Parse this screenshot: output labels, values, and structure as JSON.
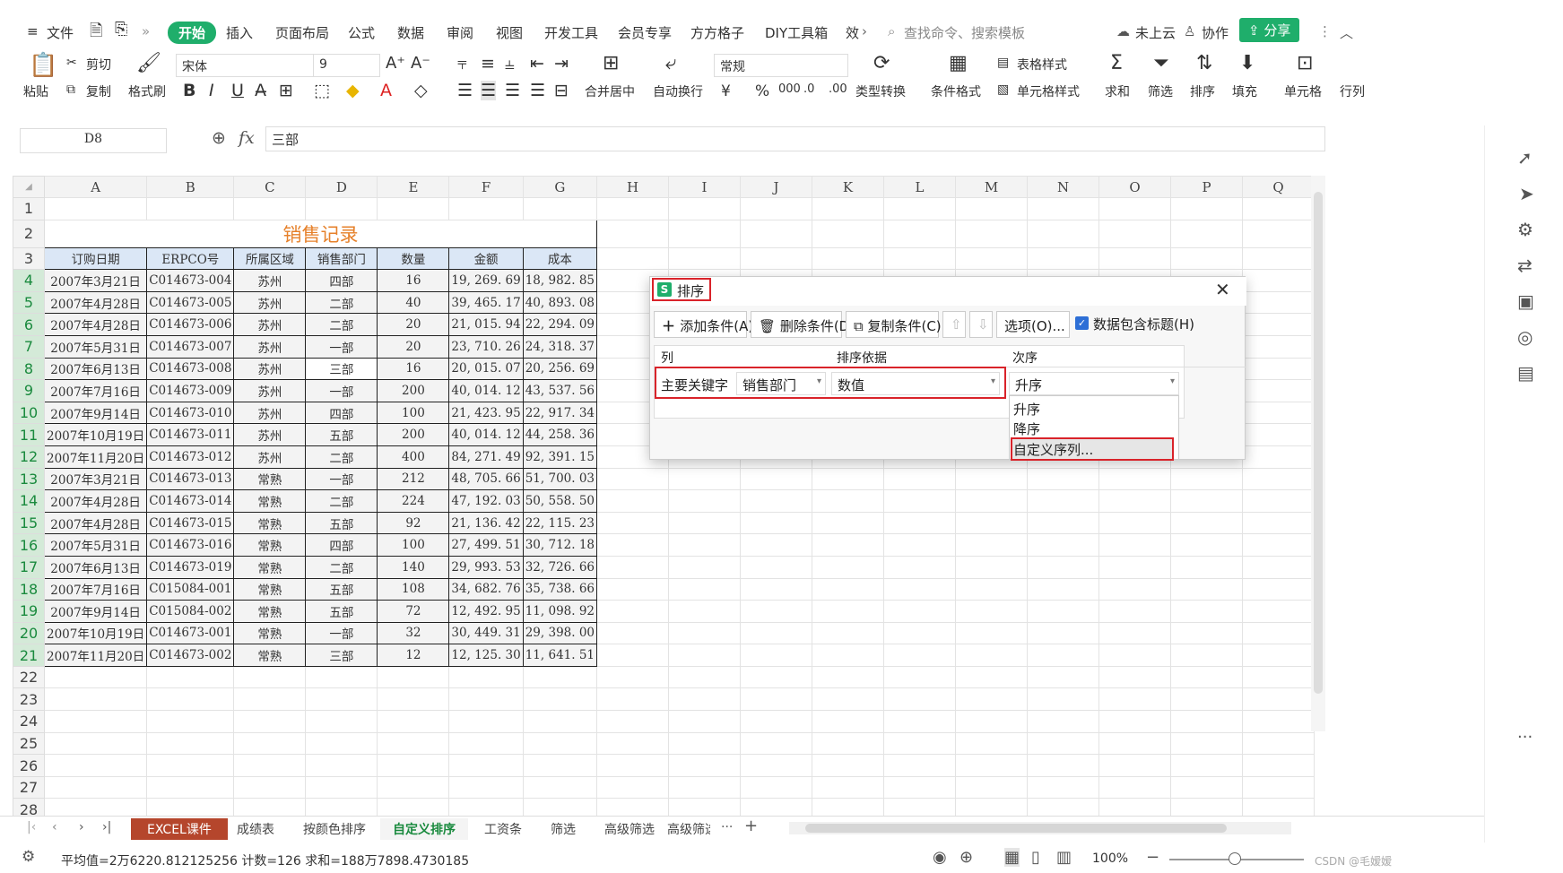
{
  "menubar": {
    "hamburger": "≡",
    "file": "文件",
    "more": "»",
    "tabs": [
      "开始",
      "插入",
      "页面布局",
      "公式",
      "数据",
      "审阅",
      "视图",
      "开发工具",
      "会员专享",
      "方方格子",
      "DIY工具箱",
      "效"
    ],
    "search": "查找命令、搜索模板",
    "cloud": "未上云",
    "collab": "协作",
    "share": "分享"
  },
  "ribbon": {
    "paste": "粘贴",
    "cut": "剪切",
    "copy": "复制",
    "format_painter": "格式刷",
    "font": "宋体",
    "size": "9",
    "merge": "合并居中",
    "wrap": "自动换行",
    "numfmt": "常规",
    "typeconv": "类型转换",
    "condfmt": "条件格式",
    "tablestyle": "表格样式",
    "cellstyle": "单元格样式",
    "sum": "求和",
    "filter": "筛选",
    "sort": "排序",
    "fill": "填充",
    "cell": "单元格",
    "rowcol": "行列",
    "currency": "¥",
    "percent": "%"
  },
  "formula": {
    "cellref": "D8",
    "fx": "fx",
    "value": "三部"
  },
  "grid": {
    "cols": [
      "A",
      "B",
      "C",
      "D",
      "E",
      "F",
      "G",
      "H",
      "I",
      "J",
      "K",
      "L",
      "M",
      "N",
      "O",
      "P",
      "Q"
    ],
    "rows": [
      "1",
      "2",
      "3",
      "4",
      "5",
      "6",
      "7",
      "8",
      "9",
      "10",
      "11",
      "12",
      "13",
      "14",
      "15",
      "16",
      "17",
      "18",
      "19",
      "20",
      "21",
      "22",
      "23",
      "24",
      "25",
      "26",
      "27",
      "28"
    ],
    "title": "销售记录",
    "headers": [
      "订购日期",
      "ERPCO号",
      "所属区域",
      "销售部门",
      "数量",
      "金额",
      "成本"
    ],
    "data": [
      [
        "2007年3月21日",
        "C014673-004",
        "苏州",
        "四部",
        "16",
        "19, 269. 69",
        "18, 982. 85"
      ],
      [
        "2007年4月28日",
        "C014673-005",
        "苏州",
        "二部",
        "40",
        "39, 465. 17",
        "40, 893. 08"
      ],
      [
        "2007年4月28日",
        "C014673-006",
        "苏州",
        "二部",
        "20",
        "21, 015. 94",
        "22, 294. 09"
      ],
      [
        "2007年5月31日",
        "C014673-007",
        "苏州",
        "一部",
        "20",
        "23, 710. 26",
        "24, 318. 37"
      ],
      [
        "2007年6月13日",
        "C014673-008",
        "苏州",
        "三部",
        "16",
        "20, 015. 07",
        "20, 256. 69"
      ],
      [
        "2007年7月16日",
        "C014673-009",
        "苏州",
        "一部",
        "200",
        "40, 014. 12",
        "43, 537. 56"
      ],
      [
        "2007年9月14日",
        "C014673-010",
        "苏州",
        "四部",
        "100",
        "21, 423. 95",
        "22, 917. 34"
      ],
      [
        "2007年10月19日",
        "C014673-011",
        "苏州",
        "五部",
        "200",
        "40, 014. 12",
        "44, 258. 36"
      ],
      [
        "2007年11月20日",
        "C014673-012",
        "苏州",
        "二部",
        "400",
        "84, 271. 49",
        "92, 391. 15"
      ],
      [
        "2007年3月21日",
        "C014673-013",
        "常熟",
        "一部",
        "212",
        "48, 705. 66",
        "51, 700. 03"
      ],
      [
        "2007年4月28日",
        "C014673-014",
        "常熟",
        "二部",
        "224",
        "47, 192. 03",
        "50, 558. 50"
      ],
      [
        "2007年4月28日",
        "C014673-015",
        "常熟",
        "五部",
        "92",
        "21, 136. 42",
        "22, 115. 23"
      ],
      [
        "2007年5月31日",
        "C014673-016",
        "常熟",
        "四部",
        "100",
        "27, 499. 51",
        "30, 712. 18"
      ],
      [
        "2007年6月13日",
        "C014673-019",
        "常熟",
        "二部",
        "140",
        "29, 993. 53",
        "32, 726. 66"
      ],
      [
        "2007年7月16日",
        "C015084-001",
        "常熟",
        "五部",
        "108",
        "34, 682. 76",
        "35, 738. 66"
      ],
      [
        "2007年9月14日",
        "C015084-002",
        "常熟",
        "五部",
        "72",
        "12, 492. 95",
        "11, 098. 92"
      ],
      [
        "2007年10月19日",
        "C014673-001",
        "常熟",
        "一部",
        "32",
        "30, 449. 31",
        "29, 398. 00"
      ],
      [
        "2007年11月20日",
        "C014673-002",
        "常熟",
        "三部",
        "12",
        "12, 125. 30",
        "11, 641. 51"
      ]
    ]
  },
  "dialog": {
    "title": "排序",
    "add": "添加条件(A)",
    "delete": "删除条件(D)",
    "copy": "复制条件(C)",
    "options": "选项(O)...",
    "header_check": "数据包含标题(H)",
    "col_label": "列",
    "basis_label": "排序依据",
    "order_label": "次序",
    "primary": "主要关键字",
    "column_value": "销售部门",
    "basis_value": "数值",
    "order_value": "升序",
    "options_list": [
      "升序",
      "降序",
      "自定义序列..."
    ]
  },
  "sheets": {
    "tabs": [
      "EXCEL课件",
      "成绩表",
      "按颜色排序",
      "自定义排序",
      "工资条",
      "筛选",
      "高级筛选",
      "高级筛选"
    ],
    "active": "自定义排序",
    "more": "···",
    "add": "+"
  },
  "status": {
    "text": "平均值=2万6220.812125256  计数=126  求和=188万7898.4730185",
    "zoom": "100%",
    "watermark": "CSDN @毛嫒嫒"
  }
}
